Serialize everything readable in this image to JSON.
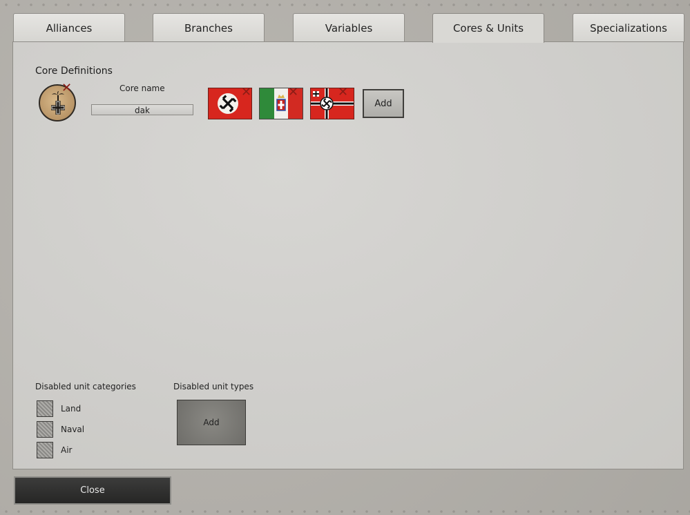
{
  "tabs": [
    {
      "label": "Alliances"
    },
    {
      "label": "Branches"
    },
    {
      "label": "Variables"
    },
    {
      "label": "Cores & Units"
    },
    {
      "label": "Specializations"
    }
  ],
  "active_tab": "Cores & Units",
  "core_definitions": {
    "title": "Core Definitions",
    "core_name_label": "Core name",
    "core_name_value": "dak",
    "emblem_icon": "afrika-korps-palm-cross-icon",
    "flags": [
      {
        "icon": "germany-swastika-flag-icon"
      },
      {
        "icon": "italy-savoy-flag-icon"
      },
      {
        "icon": "german-war-ensign-flag-icon"
      }
    ],
    "add_label": "Add"
  },
  "disabled_categories": {
    "title": "Disabled unit categories",
    "items": [
      {
        "label": "Land"
      },
      {
        "label": "Naval"
      },
      {
        "label": "Air"
      }
    ]
  },
  "disabled_types": {
    "title": "Disabled unit types",
    "add_label": "Add"
  },
  "footer": {
    "close_label": "Close"
  }
}
